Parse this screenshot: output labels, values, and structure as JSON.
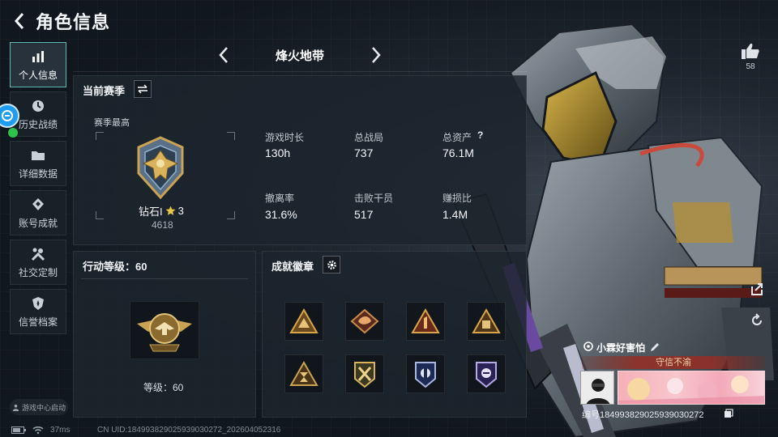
{
  "header": {
    "title": "角色信息"
  },
  "sidebar": {
    "items": [
      {
        "label": "个人信息",
        "icon": "bar-chart-icon",
        "active": true
      },
      {
        "label": "历史战绩",
        "icon": "clock-icon",
        "active": false
      },
      {
        "label": "详细数据",
        "icon": "folder-icon",
        "active": false
      },
      {
        "label": "账号成就",
        "icon": "diamond-badge-icon",
        "active": false
      },
      {
        "label": "社交定制",
        "icon": "tools-icon",
        "active": false
      },
      {
        "label": "信誉档案",
        "icon": "shield-icon",
        "active": false
      }
    ],
    "game_center": "游戏中心启动"
  },
  "map_selector": {
    "name": "烽火地带"
  },
  "season": {
    "title": "当前赛季",
    "best_label": "赛季最高",
    "rank_name": "钻石I",
    "rank_stars": "3",
    "rank_points": "4618",
    "stats": [
      {
        "label": "游戏时长",
        "value": "130h"
      },
      {
        "label": "总战局",
        "value": "737"
      },
      {
        "label": "总资产",
        "value": "76.1M",
        "help": "?"
      },
      {
        "label": "撤离率",
        "value": "31.6%"
      },
      {
        "label": "击败干员",
        "value": "517"
      },
      {
        "label": "赚损比",
        "value": "1.4M"
      }
    ]
  },
  "action_level": {
    "title": "行动等级：60",
    "level_text": "等级：60"
  },
  "achievements": {
    "title": "成就徽章"
  },
  "right": {
    "likes": "58",
    "player_name": "小霖好害怕",
    "player_title": "守信不渝",
    "player_id": "编号1849938290259390302​72"
  },
  "status_bar": {
    "latency": "37ms",
    "uid": "CN UID:184993829025939030272_202604052316"
  },
  "colors": {
    "accent": "#5fb9b0",
    "gold": "#c9a253",
    "ribbon": "#962d23"
  }
}
